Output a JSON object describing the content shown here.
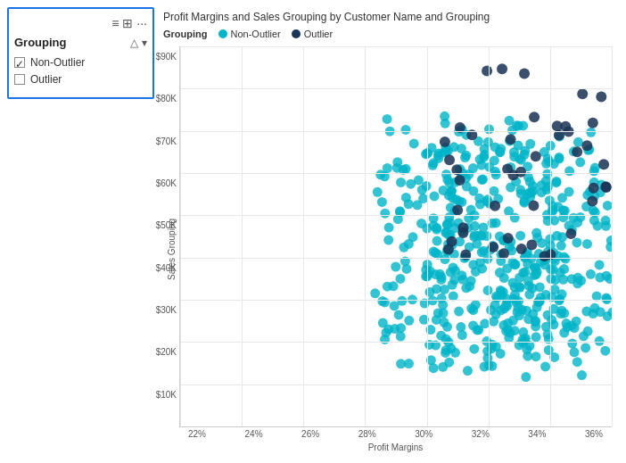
{
  "leftPanel": {
    "title": "Grouping",
    "filterItems": [
      {
        "label": "Non-Outlier",
        "checked": true
      },
      {
        "label": "Outlier",
        "checked": false
      }
    ]
  },
  "chart": {
    "title": "Profit Margins and Sales Grouping by Customer Name and Grouping",
    "legend": {
      "groupingLabel": "Grouping",
      "items": [
        {
          "label": "Non-Outlier",
          "color": "#00B4C8"
        },
        {
          "label": "Outlier",
          "color": "#1C3557"
        }
      ]
    },
    "yAxisLabel": "Sales Grouping",
    "xAxisLabel": "Profit Margins",
    "yTicks": [
      "$90K",
      "$80K",
      "$70K",
      "$60K",
      "$50K",
      "$40K",
      "$30K",
      "$20K",
      "$10K"
    ],
    "xTicks": [
      "22%",
      "24%",
      "26%",
      "28%",
      "30%",
      "32%",
      "34%",
      "36%"
    ]
  }
}
